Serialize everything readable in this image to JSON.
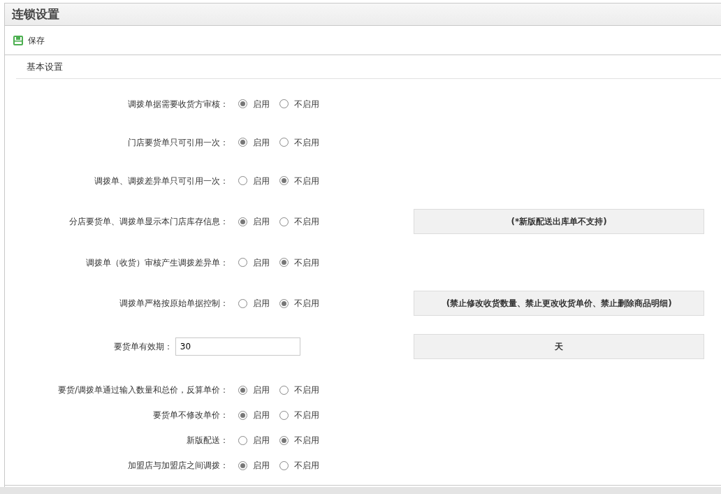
{
  "window": {
    "title": "连锁设置"
  },
  "toolbar": {
    "save_label": "保存"
  },
  "section": {
    "title": "基本设置"
  },
  "settings": [
    {
      "kind": "radio",
      "label": "调拨单据需要收货方审核：",
      "options": [
        {
          "label": "启用",
          "selected": true
        },
        {
          "label": "不启用",
          "selected": false
        }
      ]
    },
    {
      "kind": "radio",
      "label": "门店要货单只可引用一次：",
      "options": [
        {
          "label": "启用",
          "selected": true
        },
        {
          "label": "不启用",
          "selected": false
        }
      ]
    },
    {
      "kind": "radio",
      "label": "调拨单、调拨差异单只可引用一次：",
      "options": [
        {
          "label": "启用",
          "selected": false
        },
        {
          "label": "不启用",
          "selected": true
        }
      ]
    },
    {
      "kind": "radio",
      "label": "分店要货单、调拨单显示本门店库存信息：",
      "options": [
        {
          "label": "启用",
          "selected": true
        },
        {
          "label": "不启用",
          "selected": false
        }
      ],
      "note": "(*新版配送出库单不支持)"
    },
    {
      "kind": "radio",
      "label": "调拨单（收货）审核产生调拨差异单：",
      "options": [
        {
          "label": "启用",
          "selected": false
        },
        {
          "label": "不启用",
          "selected": true
        }
      ]
    },
    {
      "kind": "radio",
      "label": "调拨单严格按原始单据控制：",
      "options": [
        {
          "label": "启用",
          "selected": false
        },
        {
          "label": "不启用",
          "selected": true
        }
      ],
      "note": "(禁止修改收货数量、禁止更改收货单价、禁止删除商品明细)"
    },
    {
      "kind": "input",
      "label": "要货单有效期：",
      "value": "30",
      "note": "天"
    }
  ],
  "compact_settings": [
    {
      "label": "要货/调拨单通过输入数量和总价，反算单价：",
      "options": [
        {
          "label": "启用",
          "selected": true
        },
        {
          "label": "不启用",
          "selected": false
        }
      ]
    },
    {
      "label": "要货单不修改单价：",
      "options": [
        {
          "label": "启用",
          "selected": true
        },
        {
          "label": "不启用",
          "selected": false
        }
      ]
    },
    {
      "label": "新版配送：",
      "options": [
        {
          "label": "启用",
          "selected": false
        },
        {
          "label": "不启用",
          "selected": true
        }
      ]
    },
    {
      "label": "加盟店与加盟店之间调拨：",
      "options": [
        {
          "label": "启用",
          "selected": true
        },
        {
          "label": "不启用",
          "selected": false
        }
      ]
    }
  ]
}
